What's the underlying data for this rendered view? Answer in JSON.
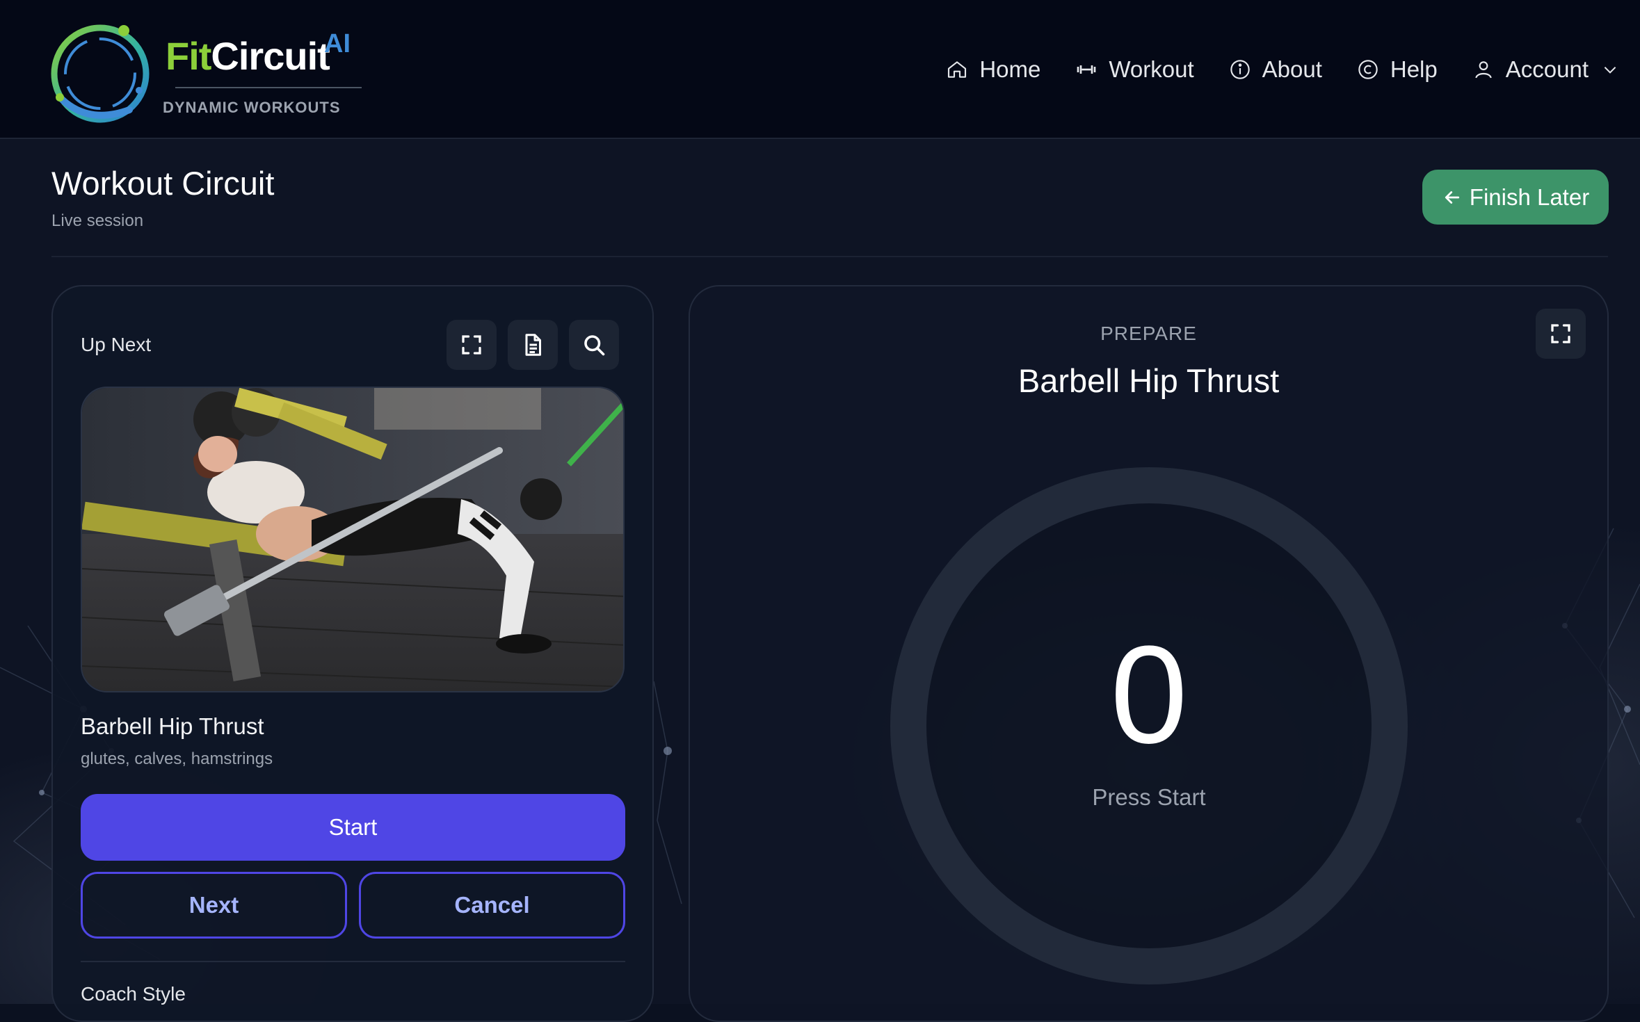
{
  "brand": {
    "name_part1": "Fit",
    "name_part2": "Circuit",
    "name_suffix": "AI",
    "tagline": "DYNAMIC WORKOUTS",
    "colors": {
      "green": "#8ccf3a",
      "blue": "#3f8cd8"
    }
  },
  "nav": {
    "items": [
      {
        "label": "Home",
        "icon": "home-icon"
      },
      {
        "label": "Workout",
        "icon": "dumbbell-icon"
      },
      {
        "label": "About",
        "icon": "info-icon"
      },
      {
        "label": "Help",
        "icon": "help-circle-icon"
      },
      {
        "label": "Account",
        "icon": "user-icon",
        "dropdown": true
      }
    ]
  },
  "page": {
    "title": "Workout Circuit",
    "subtitle": "Live session",
    "finish_label": "Finish Later"
  },
  "up_next": {
    "label": "Up Next",
    "tools": [
      "fullscreen-icon",
      "document-icon",
      "search-icon"
    ],
    "exercise_name": "Barbell Hip Thrust",
    "muscles": "glutes, calves, hamstrings",
    "start_label": "Start",
    "next_label": "Next",
    "cancel_label": "Cancel",
    "coach_style_label": "Coach Style"
  },
  "timer": {
    "phase": "PREPARE",
    "exercise_name": "Barbell Hip Thrust",
    "value": "0",
    "hint": "Press Start"
  },
  "colors": {
    "accent": "#4f46e5",
    "success": "#3d9469",
    "background": "#0b1120"
  }
}
